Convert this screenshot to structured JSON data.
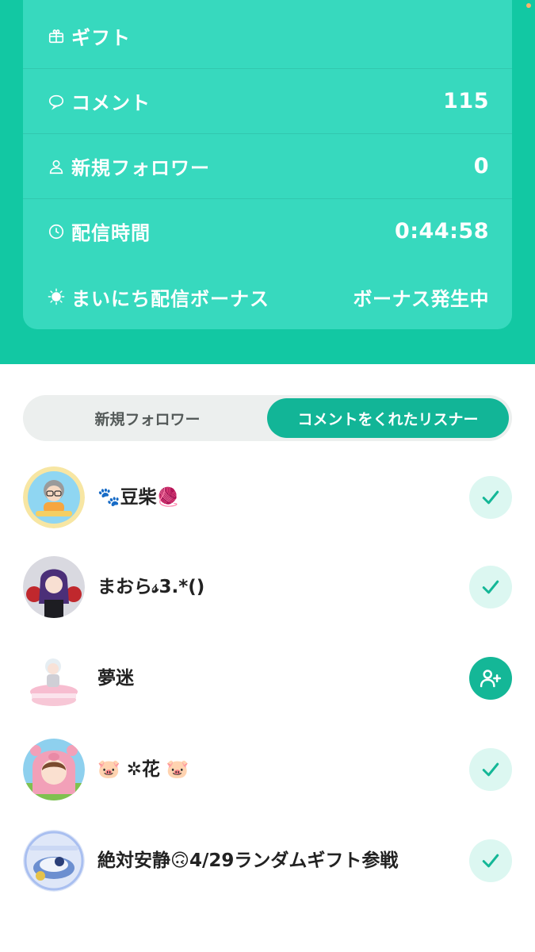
{
  "stats": {
    "rows": [
      {
        "icon": "gift-icon",
        "label": "ギフト",
        "value": ""
      },
      {
        "icon": "comment-icon",
        "label": "コメント",
        "value": "115"
      },
      {
        "icon": "person-icon",
        "label": "新規フォロワー",
        "value": "0"
      },
      {
        "icon": "clock-icon",
        "label": "配信時間",
        "value": "0:44:58"
      },
      {
        "icon": "sun-icon",
        "label": "まいにち配信ボーナス",
        "value": "ボーナス発生中"
      }
    ]
  },
  "tabs": {
    "inactive": "新規フォロワー",
    "active": "コメントをくれたリスナー"
  },
  "listeners": [
    {
      "name": "🐾豆柴🧶",
      "followed": true,
      "avatar_color": "#f4cf63"
    },
    {
      "name": "まおら𝓈3.*()",
      "followed": true,
      "avatar_color": "#2e2a3a"
    },
    {
      "name": "夢迷",
      "followed": false,
      "avatar_color": "#f7c7d6"
    },
    {
      "name": "🐷 ✲花 🐷",
      "followed": true,
      "avatar_color": "#f2a0b8"
    },
    {
      "name": "絶対安静🙃4/29ランダムギフト参戦",
      "followed": true,
      "avatar_color": "#6c8fd0"
    }
  ],
  "colors": {
    "primary": "#12c8a3",
    "card": "#37d9be",
    "accent": "#12b597",
    "check_bg": "#dcf7f1"
  }
}
